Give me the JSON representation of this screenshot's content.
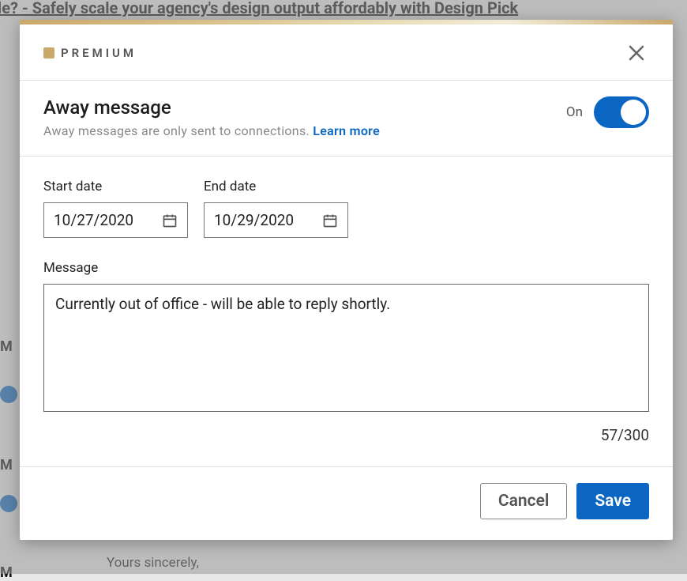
{
  "background": {
    "top_banner": "gn Pickle? - Safely scale your agency's design output affordably with Design Pick",
    "m1": "M",
    "m2": "M",
    "m3": "M",
    "sincerely": "Yours sincerely,"
  },
  "modal": {
    "premium_label": "PREMIUM",
    "title": "Away message",
    "subtitle_prefix": "Away messages are only sent to connections. ",
    "learn_more": "Learn more",
    "toggle": {
      "state_label": "On",
      "value": true
    },
    "fields": {
      "start_date": {
        "label": "Start date",
        "value": "10/27/2020"
      },
      "end_date": {
        "label": "End date",
        "value": "10/29/2020"
      },
      "message": {
        "label": "Message",
        "value": "Currently out of office - will be able to reply shortly.",
        "char_count": "57/300"
      }
    },
    "buttons": {
      "cancel": "Cancel",
      "save": "Save"
    }
  }
}
